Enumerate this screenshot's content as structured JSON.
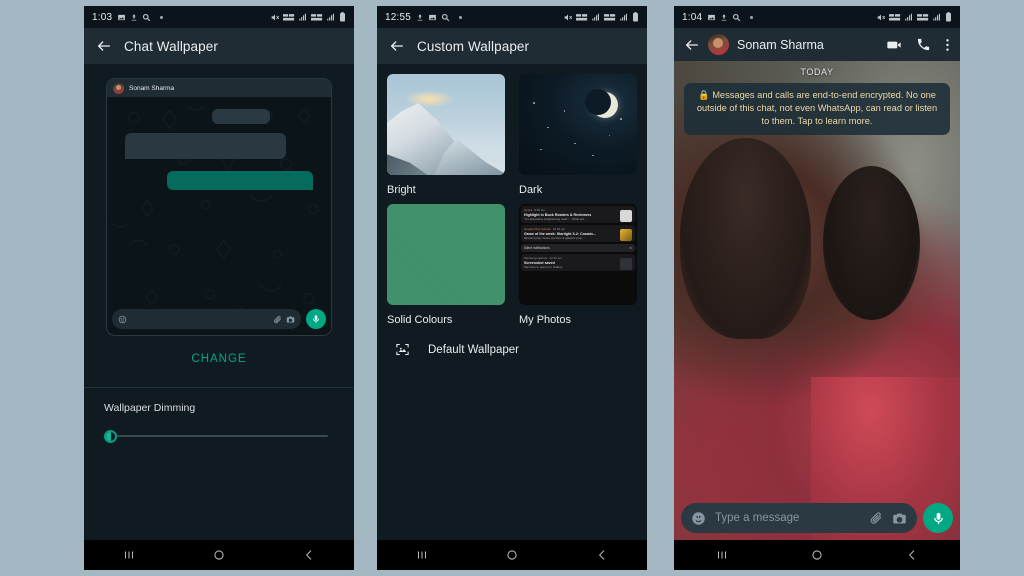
{
  "page": {
    "background_color": "#a3b8c2",
    "panel_background": "#0f1b21",
    "accent_color": "#00a884",
    "appbar_color": "#1f2c33"
  },
  "phone1": {
    "statusbar": {
      "time": "1:03",
      "icons": [
        "image-icon",
        "download-icon",
        "search-icon",
        "dot-icon"
      ],
      "right_icons": [
        "mute-icon",
        "volte-icon",
        "signal-icon",
        "volte2-icon",
        "signal2-icon",
        "battery-icon"
      ]
    },
    "appbar": {
      "back": "back-arrow",
      "title": "Chat Wallpaper"
    },
    "preview": {
      "contact_name": "Sonam Sharma",
      "input_icons": [
        "emoji-icon",
        "attach-icon",
        "camera-icon",
        "mic-icon"
      ]
    },
    "change_label": "CHANGE",
    "dimming": {
      "label": "Wallpaper Dimming",
      "value": 0
    }
  },
  "phone2": {
    "statusbar": {
      "time": "12:55"
    },
    "appbar": {
      "back": "back-arrow",
      "title": "Custom Wallpaper"
    },
    "tiles": [
      {
        "label": "Bright",
        "kind": "bright-mountain"
      },
      {
        "label": "Dark",
        "kind": "dark-moon"
      },
      {
        "label": "Solid Colours",
        "kind": "solid-green",
        "color": "#3e9168"
      },
      {
        "label": "My Photos",
        "kind": "screenshot-notifications"
      }
    ],
    "my_photos_preview": {
      "notifications": [
        {
          "app": "Quora",
          "time": "8:50 am",
          "title": "Highlight in Book Readers & Reviewers",
          "sub": "\"An absolutely enlightening read.\" – What are ..."
        },
        {
          "app": "Google Play Games",
          "time": "10:00 am",
          "title": "Game of the week: Starlight X-2: Cosmic...",
          "sub": "#Instant play. Solve puzzles of galactic prop..."
        }
      ],
      "silent_header": "Silent notifications",
      "silent": [
        {
          "app": "Samsung capture",
          "time": "12:23 pm",
          "title": "Screenshot saved",
          "sub": "Tap here to open it in Gallery."
        }
      ]
    },
    "default_row": {
      "icon": "image-placeholder-icon",
      "label": "Default Wallpaper"
    }
  },
  "phone3": {
    "statusbar": {
      "time": "1:04"
    },
    "appbar": {
      "back": "back-arrow",
      "avatar": "contact-avatar",
      "name": "Sonam Sharma",
      "actions": [
        "video-call-icon",
        "voice-call-icon",
        "overflow-menu-icon"
      ]
    },
    "chat": {
      "date_divider": "TODAY",
      "encryption_notice": "🔒 Messages and calls are end-to-end encrypted. No one outside of this chat, not even WhatsApp, can read or listen to them. Tap to learn more.",
      "input_placeholder": "Type a message",
      "input_icons": [
        "emoji-icon",
        "attach-icon",
        "camera-icon",
        "mic-icon"
      ]
    }
  },
  "navbar": {
    "recent": "recents-icon",
    "home": "home-icon",
    "back": "back-icon"
  }
}
